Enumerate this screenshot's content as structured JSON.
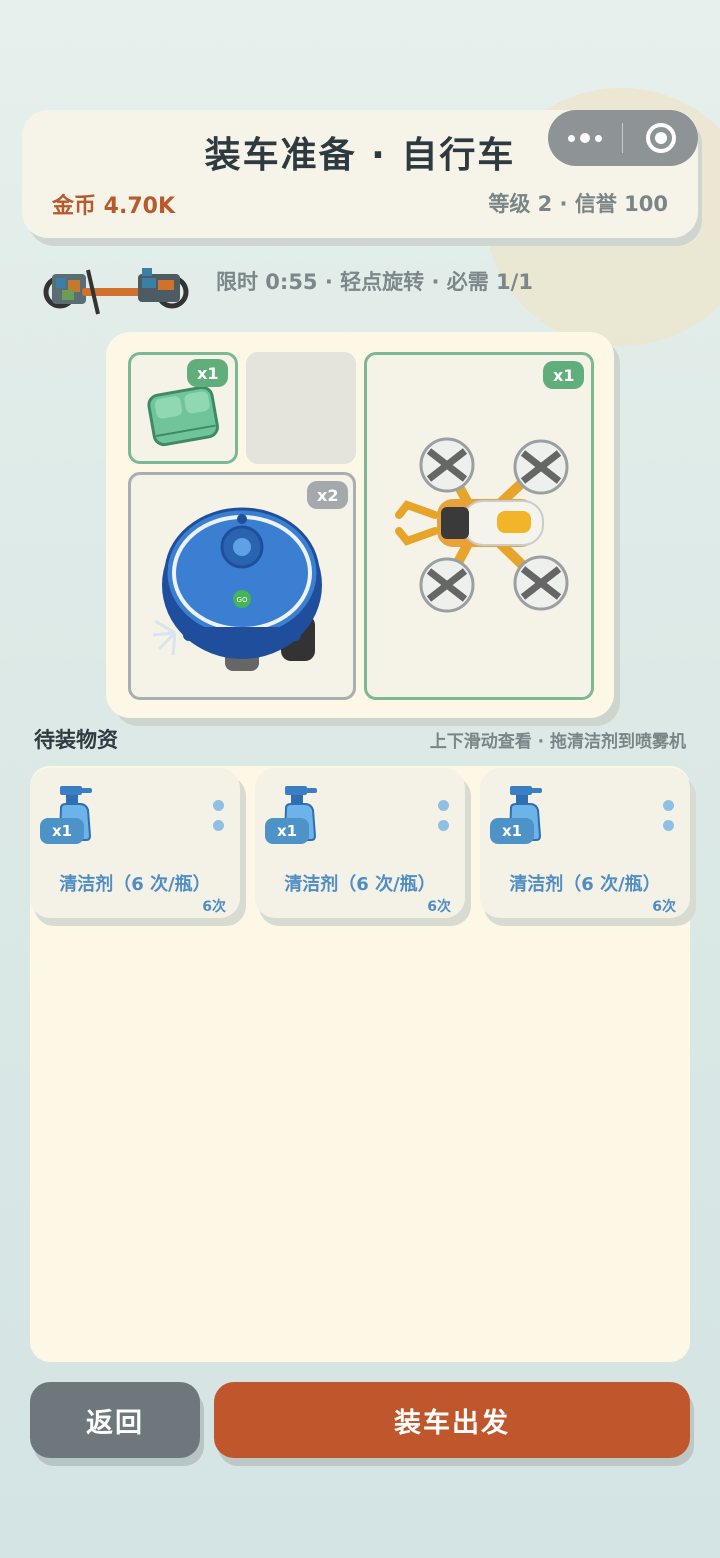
{
  "header": {
    "title": "装车准备 · 自行车",
    "coins": "金币 4.70K",
    "stats": "等级 2 · 信誉 100"
  },
  "capsule": {
    "more_icon": "more-dots-icon",
    "close_icon": "target-icon"
  },
  "info": {
    "text": "限时 0:55 · 轻点旋转 · 必需 1/1"
  },
  "board": {
    "slots": [
      {
        "item": "towel",
        "badge": "x1"
      },
      {
        "item": "empty"
      },
      {
        "item": "robot-vacuum",
        "badge": "x2"
      },
      {
        "item": "drone",
        "badge": "x1"
      }
    ]
  },
  "supplies": {
    "title": "待装物资",
    "hint": "上下滑动查看 · 拖清洁剂到喷雾机",
    "items": [
      {
        "badge": "x1",
        "name": "清洁剂（6 次/瓶）",
        "uses": "6次"
      },
      {
        "badge": "x1",
        "name": "清洁剂（6 次/瓶）",
        "uses": "6次"
      },
      {
        "badge": "x1",
        "name": "清洁剂（6 次/瓶）",
        "uses": "6次"
      }
    ]
  },
  "buttons": {
    "back": "返回",
    "depart": "装车出发"
  },
  "colors": {
    "accent": "#c0562b",
    "back_button": "#6e787c",
    "coins": "#b85a2c",
    "item_text": "#4f8dc2",
    "badge_green": "#5fae7b"
  }
}
